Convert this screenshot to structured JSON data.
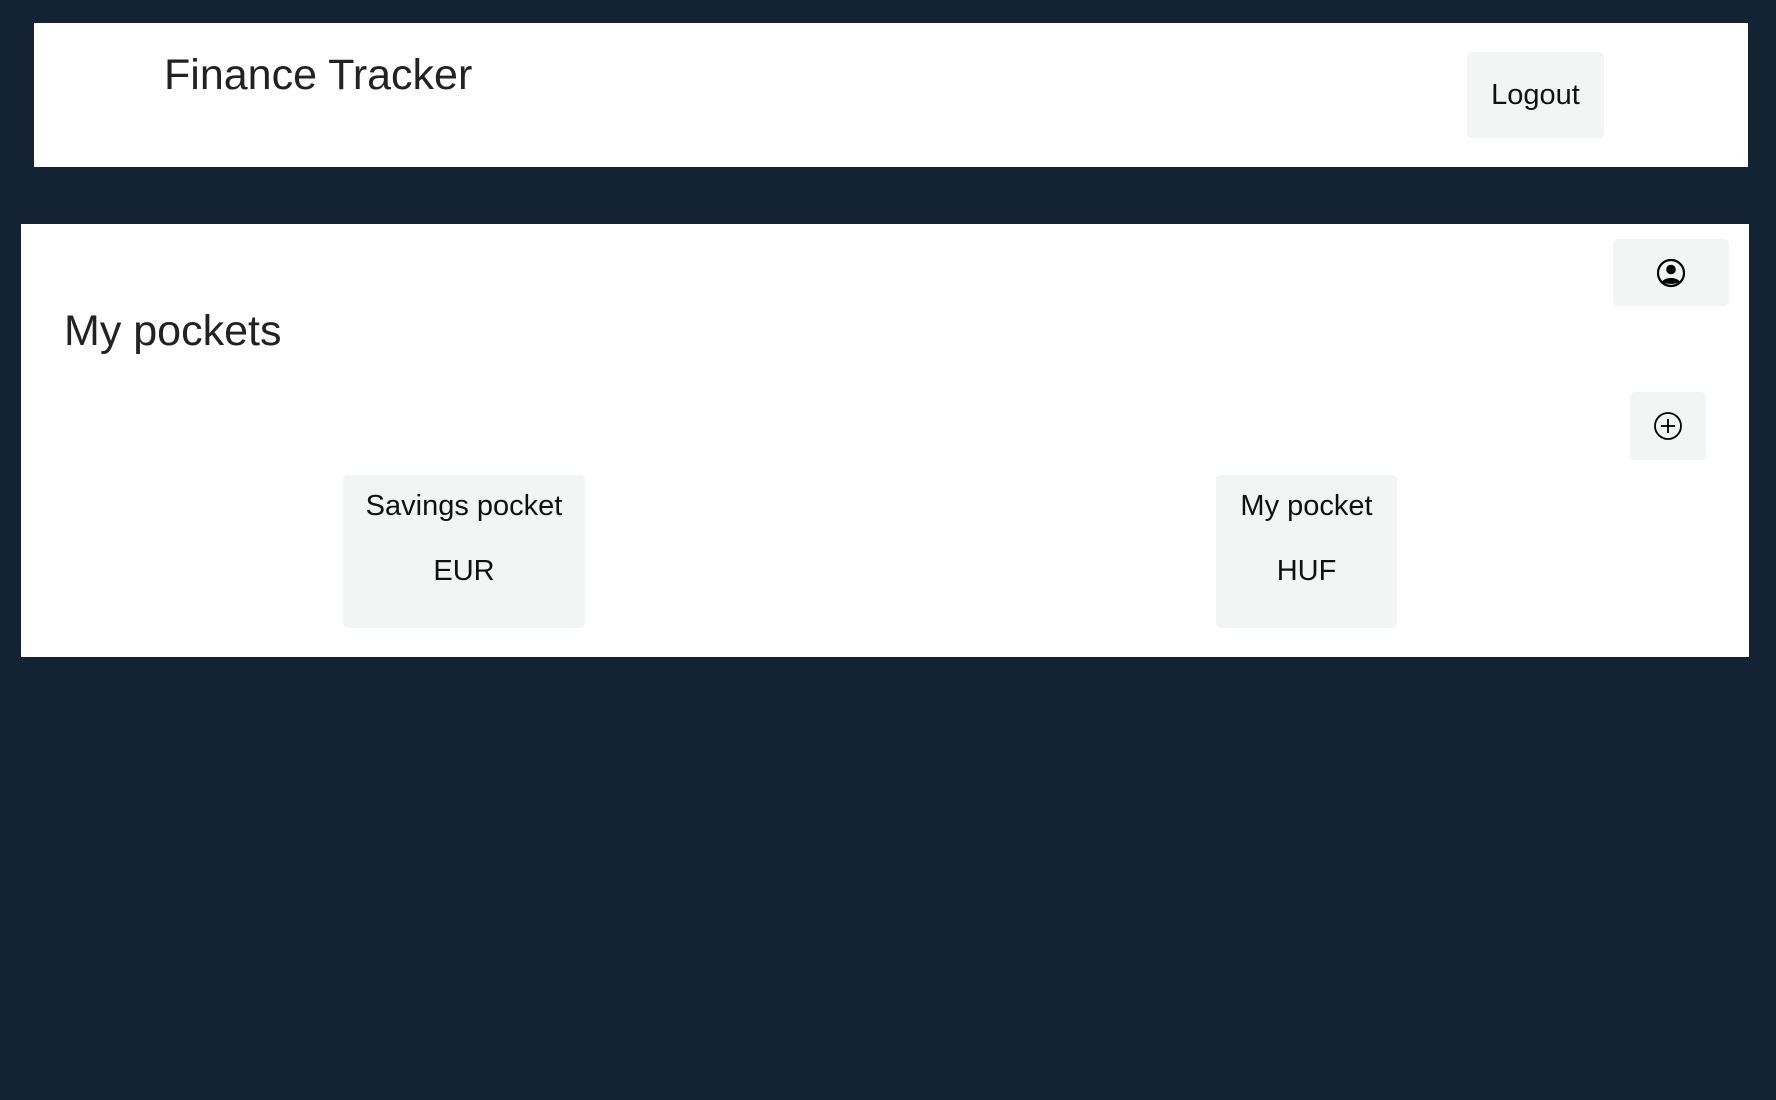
{
  "header": {
    "title": "Finance Tracker",
    "logout_label": "Logout"
  },
  "main": {
    "page_title": "My pockets",
    "profile_icon": "user-circle-icon",
    "add_icon": "plus-circle-icon",
    "pockets": [
      {
        "name": "Savings pocket",
        "currency": "EUR"
      },
      {
        "name": "My pocket",
        "currency": "HUF"
      }
    ]
  },
  "colors": {
    "background": "#132333",
    "panel": "#ffffff",
    "button": "#f3f5f4"
  }
}
